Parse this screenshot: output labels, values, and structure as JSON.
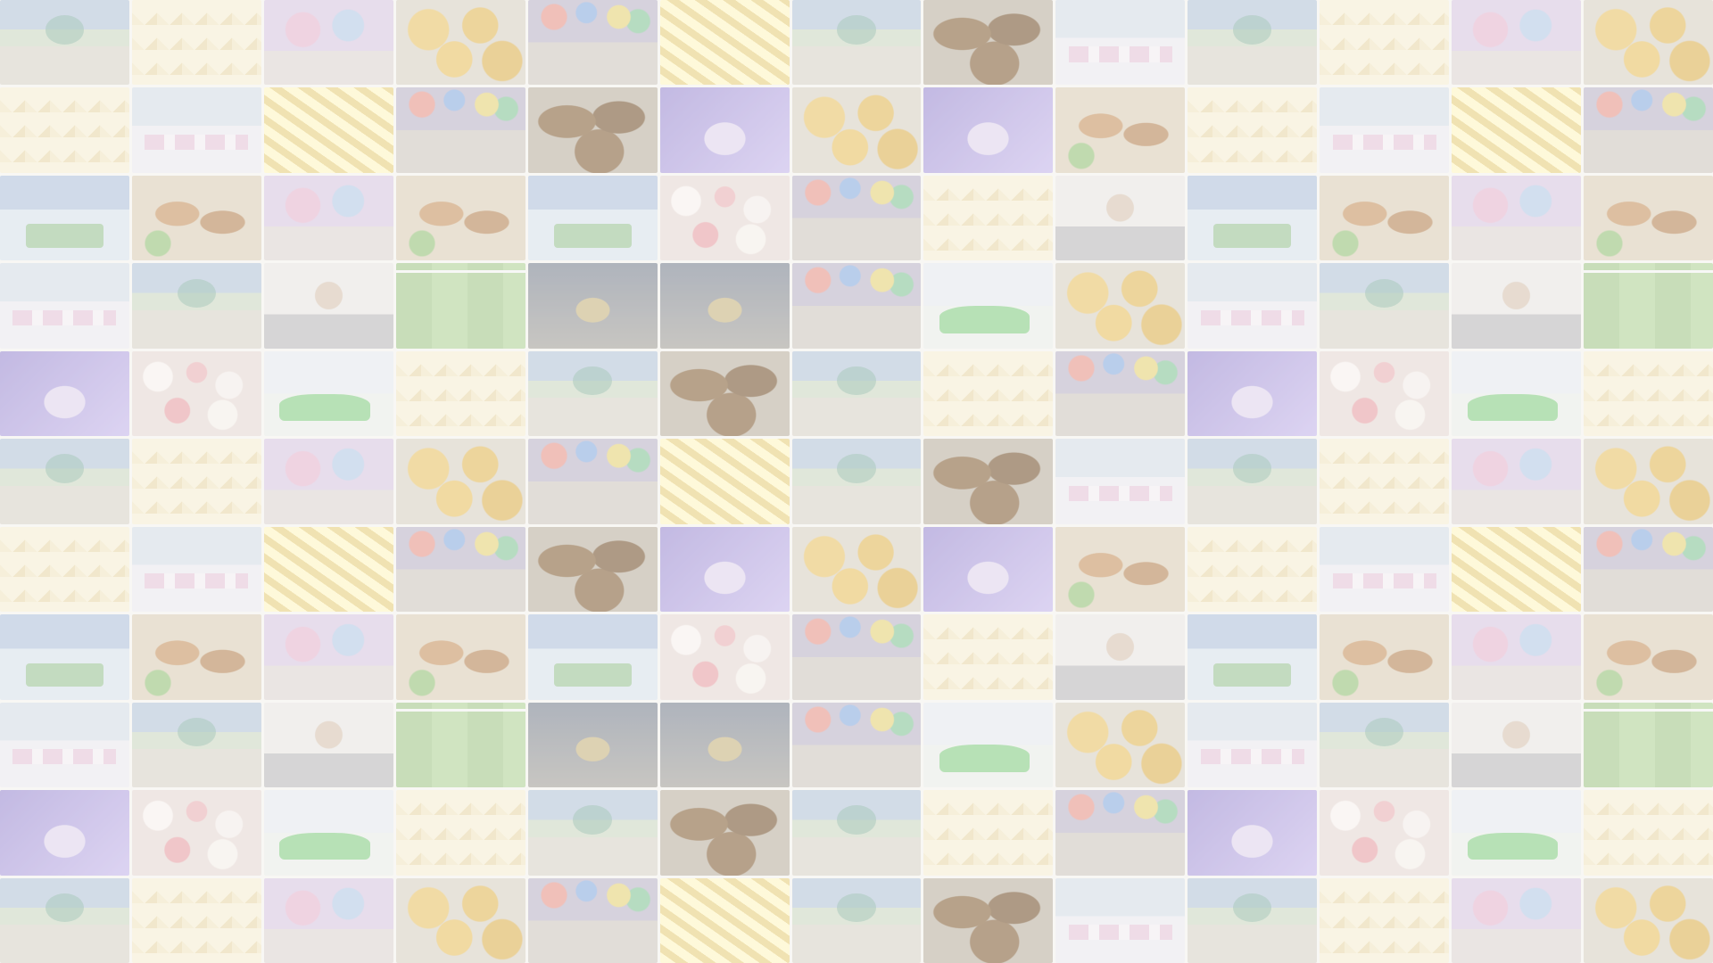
{
  "collage": {
    "tiles": [
      "party-stage",
      "food-chunks",
      "party-pink",
      "food-balls",
      "party-colorful",
      "food-fries",
      "party-stage",
      "food-brown",
      "party-hall",
      "party-stage",
      "food-chunks",
      "party-pink",
      "food-balls",
      "food-chunks",
      "party-hall",
      "food-fries",
      "party-colorful",
      "food-brown",
      "party-purple",
      "food-balls",
      "party-purple",
      "food-platter",
      "food-chunks",
      "party-hall",
      "food-fries",
      "party-colorful",
      "playground",
      "food-platter",
      "party-pink",
      "food-platter",
      "playground",
      "food-candy",
      "party-colorful",
      "food-chunks",
      "boss",
      "playground",
      "food-platter",
      "party-pink",
      "food-platter",
      "party-hall",
      "party-stage",
      "boss",
      "field",
      "party-dark",
      "party-dark",
      "party-colorful",
      "inflatable",
      "food-balls",
      "party-hall",
      "party-stage",
      "boss",
      "field",
      "party-purple",
      "food-candy",
      "inflatable",
      "food-chunks",
      "party-stage",
      "food-brown",
      "party-stage",
      "food-chunks",
      "party-colorful",
      "party-purple",
      "food-candy",
      "inflatable",
      "food-chunks",
      "party-stage",
      "food-chunks",
      "party-pink",
      "food-balls",
      "party-colorful",
      "food-fries",
      "party-stage",
      "food-brown",
      "party-hall",
      "party-stage",
      "food-chunks",
      "party-pink",
      "food-balls",
      "food-chunks",
      "party-hall",
      "food-fries",
      "party-colorful",
      "food-brown",
      "party-purple",
      "food-balls",
      "party-purple",
      "food-platter",
      "food-chunks",
      "party-hall",
      "food-fries",
      "party-colorful",
      "playground",
      "food-platter",
      "party-pink",
      "food-platter",
      "playground",
      "food-candy",
      "party-colorful",
      "food-chunks",
      "boss",
      "playground",
      "food-platter",
      "party-pink",
      "food-platter",
      "party-hall",
      "party-stage",
      "boss",
      "field",
      "party-dark",
      "party-dark",
      "party-colorful",
      "inflatable",
      "food-balls",
      "party-hall",
      "party-stage",
      "boss",
      "field",
      "party-purple",
      "food-candy",
      "inflatable",
      "food-chunks",
      "party-stage",
      "food-brown",
      "party-stage",
      "food-chunks",
      "party-colorful",
      "party-purple",
      "food-candy",
      "inflatable",
      "food-chunks",
      "party-stage",
      "food-chunks",
      "party-pink",
      "food-balls",
      "party-colorful",
      "food-fries",
      "party-stage",
      "food-brown",
      "party-hall",
      "party-stage",
      "food-chunks",
      "party-pink",
      "food-balls"
    ]
  }
}
